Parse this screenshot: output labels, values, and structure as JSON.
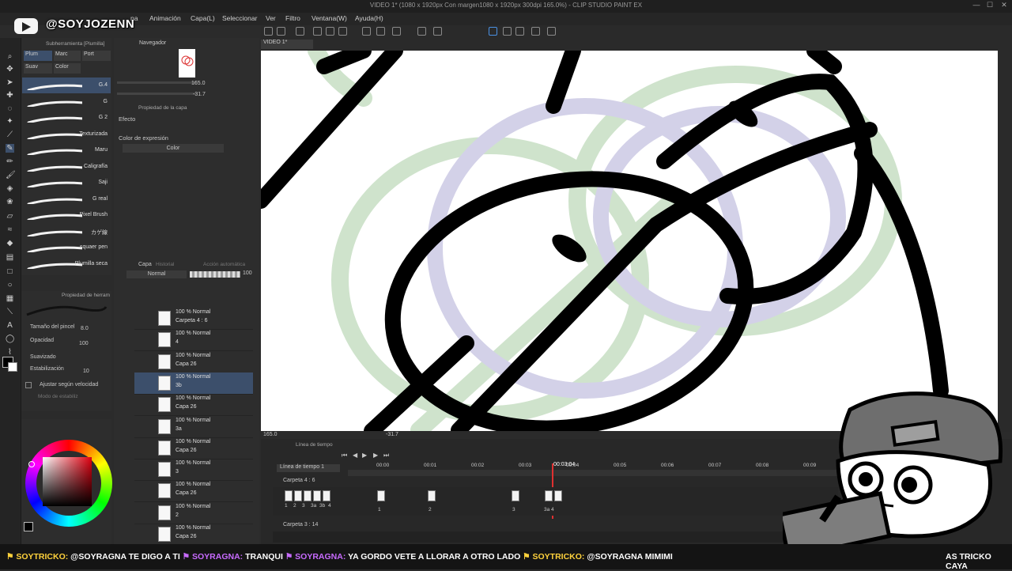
{
  "window": {
    "title": "VIDEO 1* (1080 x 1920px Con margen1080 x 1920px 300dpi 165.0%) - CLIP STUDIO PAINT EX"
  },
  "overlay": {
    "handle": "@SOYJOZENN"
  },
  "menu": {
    "items": [
      "na",
      "Animación",
      "Capa(L)",
      "Seleccionar",
      "Ver",
      "Filtro",
      "Ventana(W)",
      "Ayuda(H)"
    ]
  },
  "subtool": {
    "header": "Subherramienta [Plumilla]",
    "tabs": [
      "Plum",
      "Marc",
      "Port"
    ],
    "tabs2": [
      "Suav",
      "Color"
    ],
    "brushes": [
      "G.4",
      "G",
      "G 2",
      "Texturizada",
      "Maru",
      "Caligrafía",
      "Saji",
      "G real",
      "Pixel Brush",
      "カゲ線",
      "squaer pen",
      "Plumilla seca"
    ]
  },
  "navigator": {
    "title": "Navegador",
    "zoom": "165.0",
    "rotate": "-31.7"
  },
  "layer_property": {
    "title": "Propiedad de la capa",
    "effect": "Efecto",
    "expression_label": "Color de expresión",
    "expression_value": "Color"
  },
  "layers": {
    "tabs": [
      "Capa",
      "Historial",
      "Acción automática"
    ],
    "blend_mode": "Normal",
    "opacity": "100",
    "rows": [
      {
        "mode": "100 % Normal",
        "name": "Carpeta 4 : 6"
      },
      {
        "mode": "100 % Normal",
        "name": "4"
      },
      {
        "mode": "100 % Normal",
        "name": "Capa 26"
      },
      {
        "mode": "100 % Normal",
        "name": "3b"
      },
      {
        "mode": "100 % Normal",
        "name": "Capa 26"
      },
      {
        "mode": "100 % Normal",
        "name": "3a"
      },
      {
        "mode": "100 % Normal",
        "name": "Capa 26"
      },
      {
        "mode": "100 % Normal",
        "name": "3"
      },
      {
        "mode": "100 % Normal",
        "name": "Capa 26"
      },
      {
        "mode": "100 % Normal",
        "name": "2"
      },
      {
        "mode": "100 % Normal",
        "name": "Capa 26"
      }
    ],
    "selected_index": 3
  },
  "tool_property": {
    "title": "Propiedad de herram",
    "brush_size_label": "Tamaño del pincel",
    "brush_size": "8.0",
    "opacity_label": "Opacidad",
    "opacity": "100",
    "smoothing_label": "Suavizado",
    "stabilization_label": "Estabilización",
    "stabilization": "10",
    "speed_label": "Ajustar según velocidad",
    "mode_label": "Modo de estabiliz"
  },
  "canvas": {
    "tab": "VIDEO 1*",
    "status_zoom": "165.0",
    "status_angle": "-31.7"
  },
  "timeline": {
    "panel_title": "Línea de tiempo",
    "name": "Línea de tiempo 1",
    "current": "00:03:04",
    "seconds": [
      "00:00",
      "00:01",
      "00:02",
      "00:03",
      "00:04",
      "00:05",
      "00:06",
      "00:07",
      "00:08",
      "00:09"
    ],
    "track1": "Carpeta 4 : 6",
    "track2": "Carpeta 3 : 14",
    "cel_labels": [
      "1",
      "2",
      "3",
      "3a",
      "3b",
      "4"
    ],
    "cel_numbers_bottom": [
      "1",
      "2",
      "3",
      "3a 4"
    ]
  },
  "ticker": {
    "messages": [
      {
        "user": "SOYTRICKO",
        "text": "@SOYRAGNA TE DIGO A TI"
      },
      {
        "user": "SOYRAGNA",
        "text": "TRANQUI"
      },
      {
        "user": "SOYRAGNA",
        "text": "YA GORDO VETE A LLORAR A OTRO LADO"
      },
      {
        "user": "SOYTRICKO",
        "text": "@SOYRAGNA MIMIMI"
      }
    ],
    "tail": "AS TRICKO CAYA"
  },
  "colors": {
    "accent": "#3c4f6b",
    "ticker_user": "#ffd23c",
    "ticker_user2": "#c86bff",
    "selection": "#e00010"
  }
}
